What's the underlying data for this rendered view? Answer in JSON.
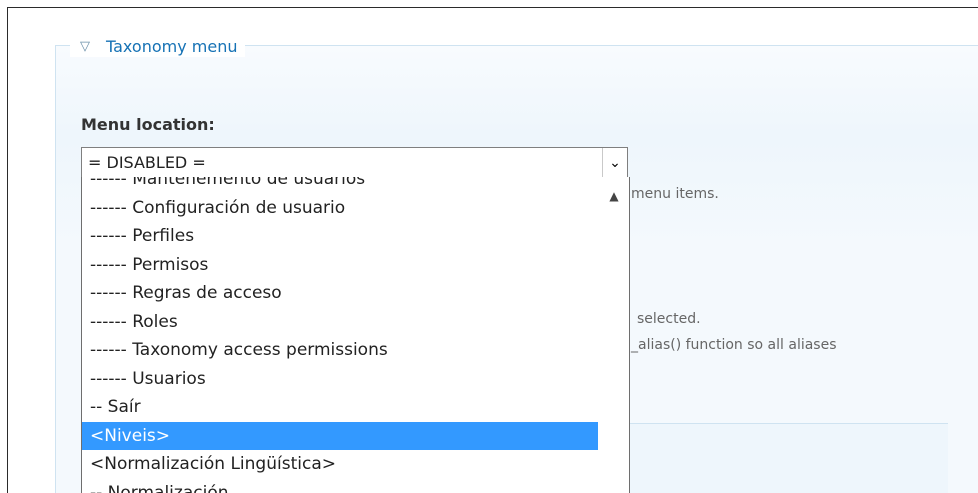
{
  "fieldset": {
    "legend_icon": "triangle-down-icon",
    "legend": "Taxonomy menu"
  },
  "menu_location": {
    "label": "Menu location:",
    "selected": "= DISABLED =",
    "arrow_icon": "chevron-down-icon",
    "scroll_up_icon": "chevron-up-icon",
    "options": [
      "------ Mantenemento de usuarios",
      "------ Configuración de usuario",
      "------ Perfiles",
      "------ Permisos",
      "------ Regras de acceso",
      "------ Roles",
      "------ Taxonomy access permissions",
      "------ Usuarios",
      "-- Saír",
      "<Niveis>",
      "<Normalización Lingüística>",
      "-- Normalización"
    ],
    "highlighted_index": 9
  },
  "descriptions": {
    "line1": "menu items.",
    "line2": "selected.",
    "line3": "_alias() function so all aliases"
  },
  "colors": {
    "link": "#1672b5",
    "highlight": "#3399ff"
  }
}
